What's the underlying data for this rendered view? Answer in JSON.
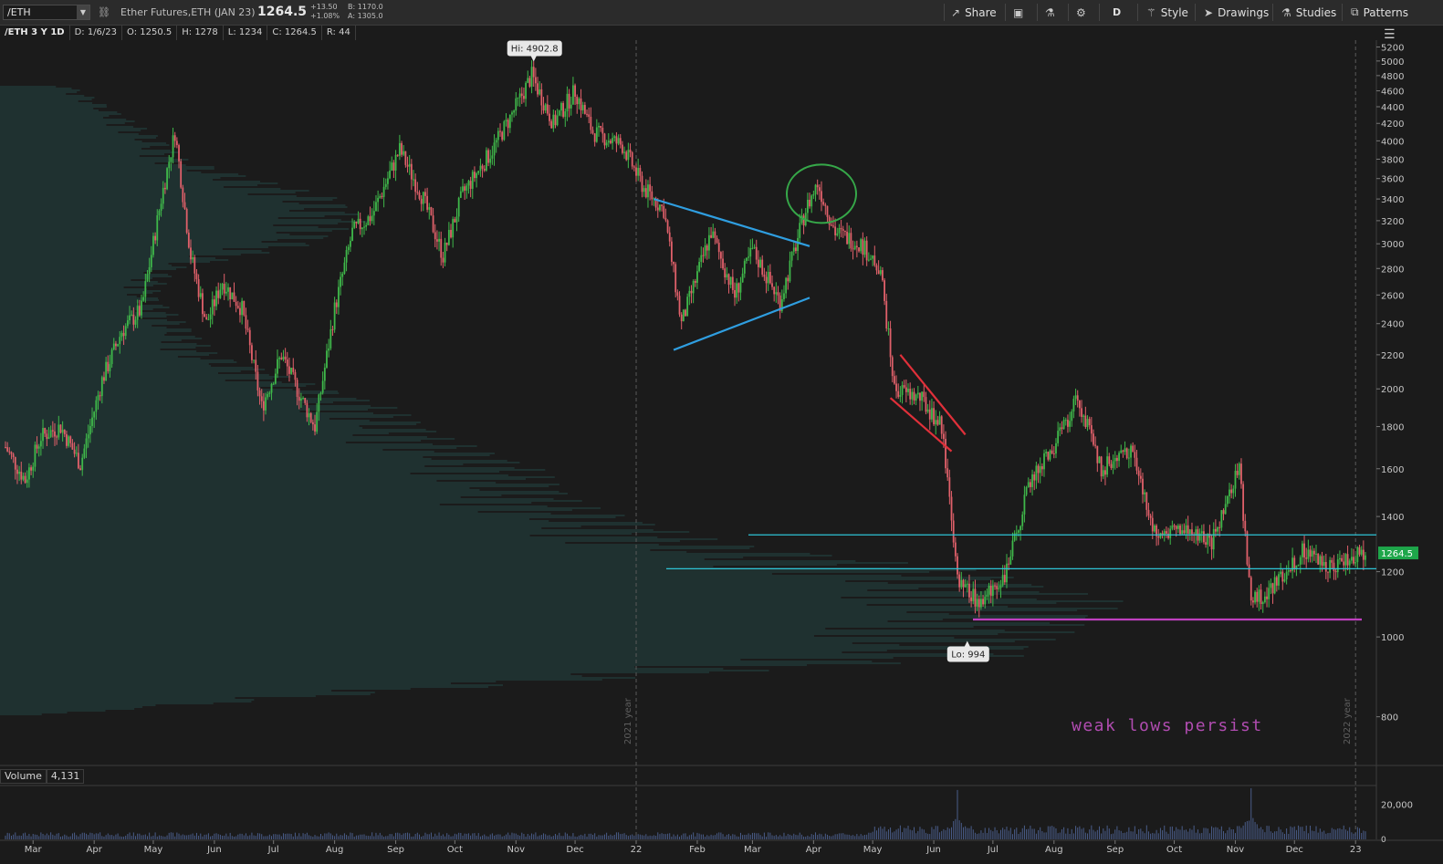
{
  "toolbar": {
    "symbol": "/ETH",
    "description": "Ether Futures,ETH (JAN 23)",
    "last": "1264.5",
    "change_abs": "+13.50",
    "change_pct": "+1.08%",
    "bid": "B: 1170.0",
    "ask": "A: 1305.0",
    "share_label": "Share",
    "aggregation": "D",
    "style_label": "Style",
    "drawings_label": "Drawings",
    "studies_label": "Studies",
    "patterns_label": "Patterns"
  },
  "ohlc_bar": {
    "title": "/ETH 3 Y 1D",
    "date": "D: 1/6/23",
    "open": "O: 1250.5",
    "high": "H: 1278",
    "low": "L: 1234",
    "close": "C: 1264.5",
    "range": "R: 44"
  },
  "volume_pane": {
    "label": "Volume",
    "value": "4,131",
    "axis_ticks": [
      "20,000",
      "0"
    ]
  },
  "colors": {
    "background": "#1b1b1b",
    "up": "#3fb84a",
    "down": "#e0606a",
    "wedge": "#2f9ee0",
    "channel": "#e0303a",
    "circle": "#36a849",
    "levels": "#2ec4d6",
    "support": "#c040c0",
    "price_tag": "#1ea64a"
  },
  "annotations": {
    "hi_label": "Hi: 4902.8",
    "lo_label": "Lo: 994",
    "year_2021": "2021 year",
    "year_2022": "2022 year",
    "note": "weak lows persist",
    "price_tag": "1264.5"
  },
  "chart_data": {
    "type": "candlestick",
    "y_axis": {
      "range": [
        700,
        5300
      ],
      "ticks": [
        800,
        1000,
        1200,
        1400,
        1600,
        1800,
        2000,
        2200,
        2400,
        2600,
        2800,
        3000,
        3200,
        3400,
        3600,
        3800,
        4000,
        4200,
        4400,
        4600,
        4800,
        5000,
        5200
      ]
    },
    "x_ticks": [
      "Mar",
      "Apr",
      "May",
      "Jun",
      "Jul",
      "Aug",
      "Sep",
      "Oct",
      "Nov",
      "Dec",
      "22",
      "Feb",
      "Mar",
      "Apr",
      "May",
      "Jun",
      "Jul",
      "Aug",
      "Sep",
      "Oct",
      "Nov",
      "Dec",
      "23"
    ],
    "x_range": [
      "2021-02-15",
      "2023-01-06"
    ],
    "price_path": [
      [
        "2021-02-15",
        1700
      ],
      [
        "2021-02-25",
        1550
      ],
      [
        "2021-03-05",
        1750
      ],
      [
        "2021-03-15",
        1800
      ],
      [
        "2021-03-25",
        1620
      ],
      [
        "2021-04-05",
        2050
      ],
      [
        "2021-04-15",
        2350
      ],
      [
        "2021-04-25",
        2500
      ],
      [
        "2021-05-05",
        3400
      ],
      [
        "2021-05-12",
        4100
      ],
      [
        "2021-05-20",
        2900
      ],
      [
        "2021-05-28",
        2400
      ],
      [
        "2021-06-05",
        2700
      ],
      [
        "2021-06-15",
        2500
      ],
      [
        "2021-06-25",
        1900
      ],
      [
        "2021-07-05",
        2200
      ],
      [
        "2021-07-15",
        1950
      ],
      [
        "2021-07-22",
        1800
      ],
      [
        "2021-08-01",
        2500
      ],
      [
        "2021-08-10",
        3100
      ],
      [
        "2021-08-20",
        3250
      ],
      [
        "2021-09-03",
        3900
      ],
      [
        "2021-09-15",
        3400
      ],
      [
        "2021-09-25",
        2900
      ],
      [
        "2021-10-05",
        3450
      ],
      [
        "2021-10-20",
        3900
      ],
      [
        "2021-11-01",
        4400
      ],
      [
        "2021-11-09",
        4800
      ],
      [
        "2021-11-20",
        4200
      ],
      [
        "2021-12-01",
        4600
      ],
      [
        "2021-12-10",
        4100
      ],
      [
        "2021-12-25",
        3950
      ],
      [
        "2022-01-05",
        3500
      ],
      [
        "2022-01-15",
        3300
      ],
      [
        "2022-01-24",
        2400
      ],
      [
        "2022-02-08",
        3100
      ],
      [
        "2022-02-20",
        2600
      ],
      [
        "2022-03-01",
        2950
      ],
      [
        "2022-03-15",
        2550
      ],
      [
        "2022-03-28",
        3300
      ],
      [
        "2022-04-03",
        3550
      ],
      [
        "2022-04-12",
        3100
      ],
      [
        "2022-04-25",
        3000
      ],
      [
        "2022-05-05",
        2800
      ],
      [
        "2022-05-12",
        2000
      ],
      [
        "2022-05-25",
        1950
      ],
      [
        "2022-06-05",
        1800
      ],
      [
        "2022-06-14",
        1150
      ],
      [
        "2022-06-25",
        1100
      ],
      [
        "2022-07-08",
        1200
      ],
      [
        "2022-07-20",
        1550
      ],
      [
        "2022-08-01",
        1700
      ],
      [
        "2022-08-13",
        1950
      ],
      [
        "2022-08-25",
        1600
      ],
      [
        "2022-09-09",
        1700
      ],
      [
        "2022-09-20",
        1350
      ],
      [
        "2022-10-05",
        1350
      ],
      [
        "2022-10-20",
        1300
      ],
      [
        "2022-11-03",
        1600
      ],
      [
        "2022-11-09",
        1100
      ],
      [
        "2022-11-20",
        1150
      ],
      [
        "2022-12-05",
        1270
      ],
      [
        "2022-12-20",
        1220
      ],
      [
        "2023-01-06",
        1264.5
      ]
    ],
    "volume_range": [
      0,
      30000
    ],
    "volume_peaks": [
      [
        "2022-06-13",
        28000
      ],
      [
        "2022-11-09",
        29000
      ]
    ],
    "annotations": {
      "high": {
        "date": "2021-11-10",
        "price": 4902.8
      },
      "low": {
        "date": "2022-06-18",
        "price": 994
      },
      "resistance_levels": [
        1330,
        1210
      ],
      "support_level": 1050,
      "triangle_upper": [
        [
          "2022-01-10",
          3400
        ],
        [
          "2022-03-30",
          2980
        ]
      ],
      "triangle_lower": [
        [
          "2022-01-20",
          2230
        ],
        [
          "2022-03-30",
          2580
        ]
      ],
      "channel_upper": [
        [
          "2022-05-15",
          2200
        ],
        [
          "2022-06-17",
          1760
        ]
      ],
      "channel_lower": [
        [
          "2022-05-10",
          1950
        ],
        [
          "2022-06-10",
          1680
        ]
      ],
      "circle_center": {
        "date": "2022-04-05",
        "price": 3450
      }
    }
  }
}
